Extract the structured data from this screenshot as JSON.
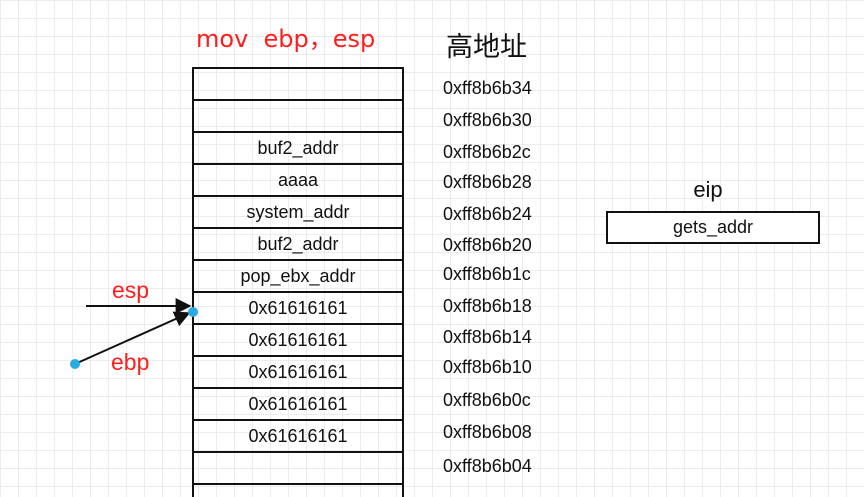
{
  "title_instruction": "mov  ebp，esp",
  "title_high_address": "高地址",
  "stack_cells": [
    "",
    "",
    "buf2_addr",
    "aaaa",
    "system_addr",
    "buf2_addr",
    "pop_ebx_addr",
    "0x61616161",
    "0x61616161",
    "0x61616161",
    "0x61616161",
    "0x61616161",
    ""
  ],
  "addresses": [
    "0xff8b6b34",
    "0xff8b6b30",
    "0xff8b6b2c",
    "0xff8b6b28",
    "0xff8b6b24",
    "0xff8b6b20",
    "0xff8b6b1c",
    "0xff8b6b18",
    "0xff8b6b14",
    "0xff8b6b10",
    "0xff8b6b0c",
    "0xff8b6b08",
    "0xff8b6b04"
  ],
  "eip": {
    "label": "eip",
    "value": "gets_addr"
  },
  "pointers": {
    "esp": "esp",
    "ebp": "ebp"
  },
  "colors": {
    "red": "#ff1e1e",
    "dot": "#29abe2",
    "ink": "#111111"
  }
}
